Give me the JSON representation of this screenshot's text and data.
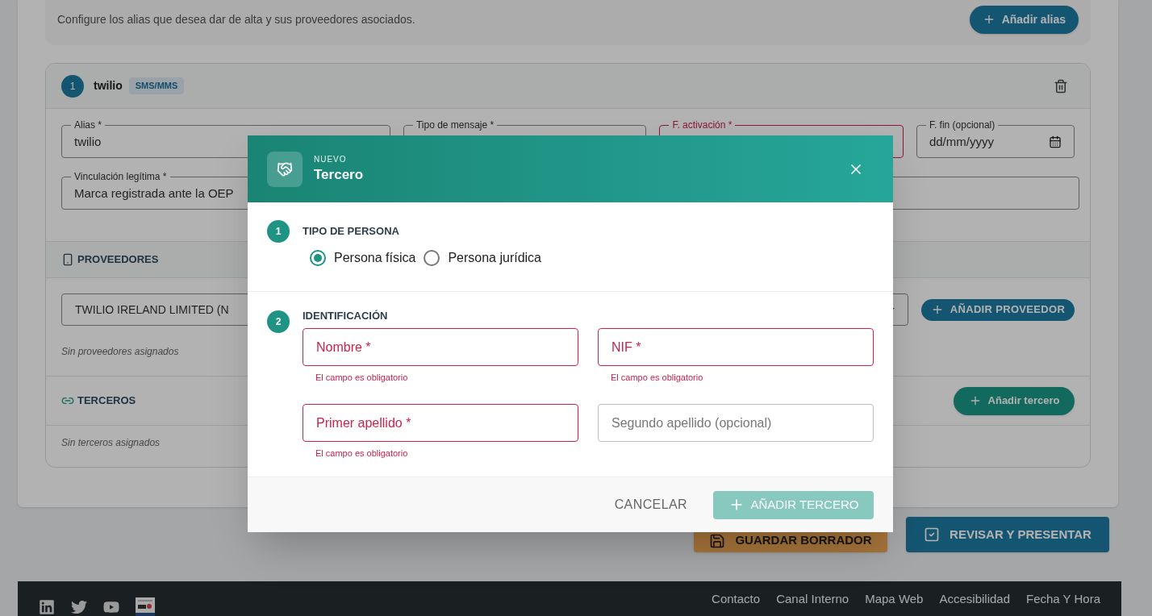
{
  "intro": {
    "text": "Configure los alias que desea dar de alta y sus proveedores asociados.",
    "add_button": "Añadir alias"
  },
  "alias_card": {
    "number": "1",
    "name": "twilio",
    "chip": "SMS/MMS",
    "fields": [
      {
        "label": "Alias *",
        "value": "twilio",
        "error": false,
        "kind": "text"
      },
      {
        "label": "Tipo de mensaje *",
        "error": false,
        "kind": "text"
      },
      {
        "label": "F. activación *",
        "error": true,
        "kind": "text"
      },
      {
        "label": "F. fin (opcional)",
        "value": "dd/mm/yyyy",
        "error": false,
        "kind": "date"
      }
    ],
    "link_field": {
      "label": "Vinculación legítima *",
      "value": "Marca registrada ante la OEP"
    },
    "providers": {
      "title": "PROVEEDORES",
      "select_value": "TWILIO IRELAND LIMITED (N",
      "add_button": "AÑADIR PROVEEDOR",
      "empty": "Sin proveedores asignados"
    },
    "third_parties": {
      "title": "TERCEROS",
      "add_button": "Añadir tercero",
      "empty": "Sin terceros asignados"
    }
  },
  "actions": [
    {
      "label": "GUARDAR BORRADOR",
      "kind": "draft"
    },
    {
      "label": "REVISAR Y PRESENTAR",
      "kind": "submit"
    }
  ],
  "footer": {
    "links": [
      "Contacto",
      "Canal Interno",
      "Mapa Web",
      "Accesibilidad",
      "Fecha Y Hora"
    ]
  },
  "modal": {
    "eyebrow": "NUEVO",
    "title": "Tercero",
    "sections": [
      {
        "number": "1",
        "title": "TIPO DE PERSONA",
        "kind": "radios",
        "options": [
          {
            "label": "Persona física",
            "selected": true
          },
          {
            "label": "Persona jurídica",
            "selected": false
          }
        ]
      },
      {
        "number": "2",
        "title": "IDENTIFICACIÓN",
        "kind": "fields",
        "fields": [
          {
            "placeholder": "Nombre *",
            "error": true,
            "message": "El campo es obligatorio"
          },
          {
            "placeholder": "NIF *",
            "error": true,
            "message": "El campo es obligatorio"
          },
          {
            "placeholder": "Primer apellido *",
            "error": true,
            "message": "El campo es obligatorio"
          },
          {
            "placeholder": "Segundo apellido (opcional)",
            "error": false
          }
        ]
      }
    ],
    "cancel": "CANCELAR",
    "submit": {
      "label": "AÑADIR TERCERO",
      "disabled": true
    }
  }
}
